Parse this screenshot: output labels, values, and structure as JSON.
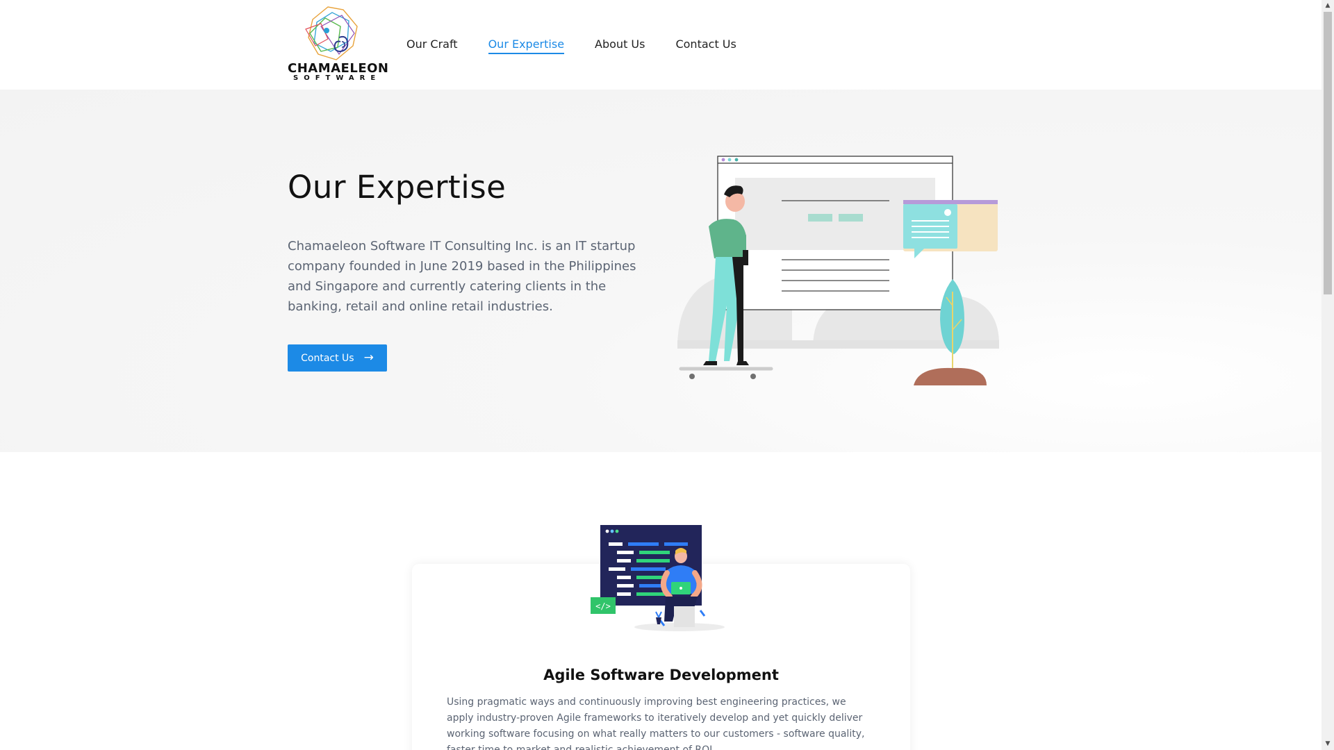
{
  "brand": {
    "name": "CHAMAELEON",
    "sub": "SOFTWARE"
  },
  "nav": {
    "items": [
      {
        "label": "Our Craft"
      },
      {
        "label": "Our Expertise",
        "active": true
      },
      {
        "label": "About Us"
      },
      {
        "label": "Contact Us"
      }
    ]
  },
  "hero": {
    "title": "Our Expertise",
    "description": "Chamaeleon Software IT Consulting Inc. is an IT startup company founded in June 2019 based in the Philippines and Singapore and currently catering clients in the banking, retail and online retail industries.",
    "button_label": "Contact Us",
    "button_arrow": "→",
    "illustration_icon": "person-browser-illustration"
  },
  "card": {
    "title": "Agile Software Development",
    "description": "Using pragmatic ways and continuously improving best engineering practices, we apply industry-proven Agile frameworks to iteratively develop and yet quickly deliver working software focusing on what really matters to our customers - software quality, faster time to market and realistic achievement of ROI.",
    "illustration_icon": "developer-code-illustration",
    "code_tag": "</>"
  },
  "colors": {
    "accent": "#1c8ae6",
    "text_muted": "#5b6473",
    "hero_bg": "#f3f3f3"
  },
  "scrollbar": {
    "up_icon": "▲",
    "down_icon": "▼"
  }
}
